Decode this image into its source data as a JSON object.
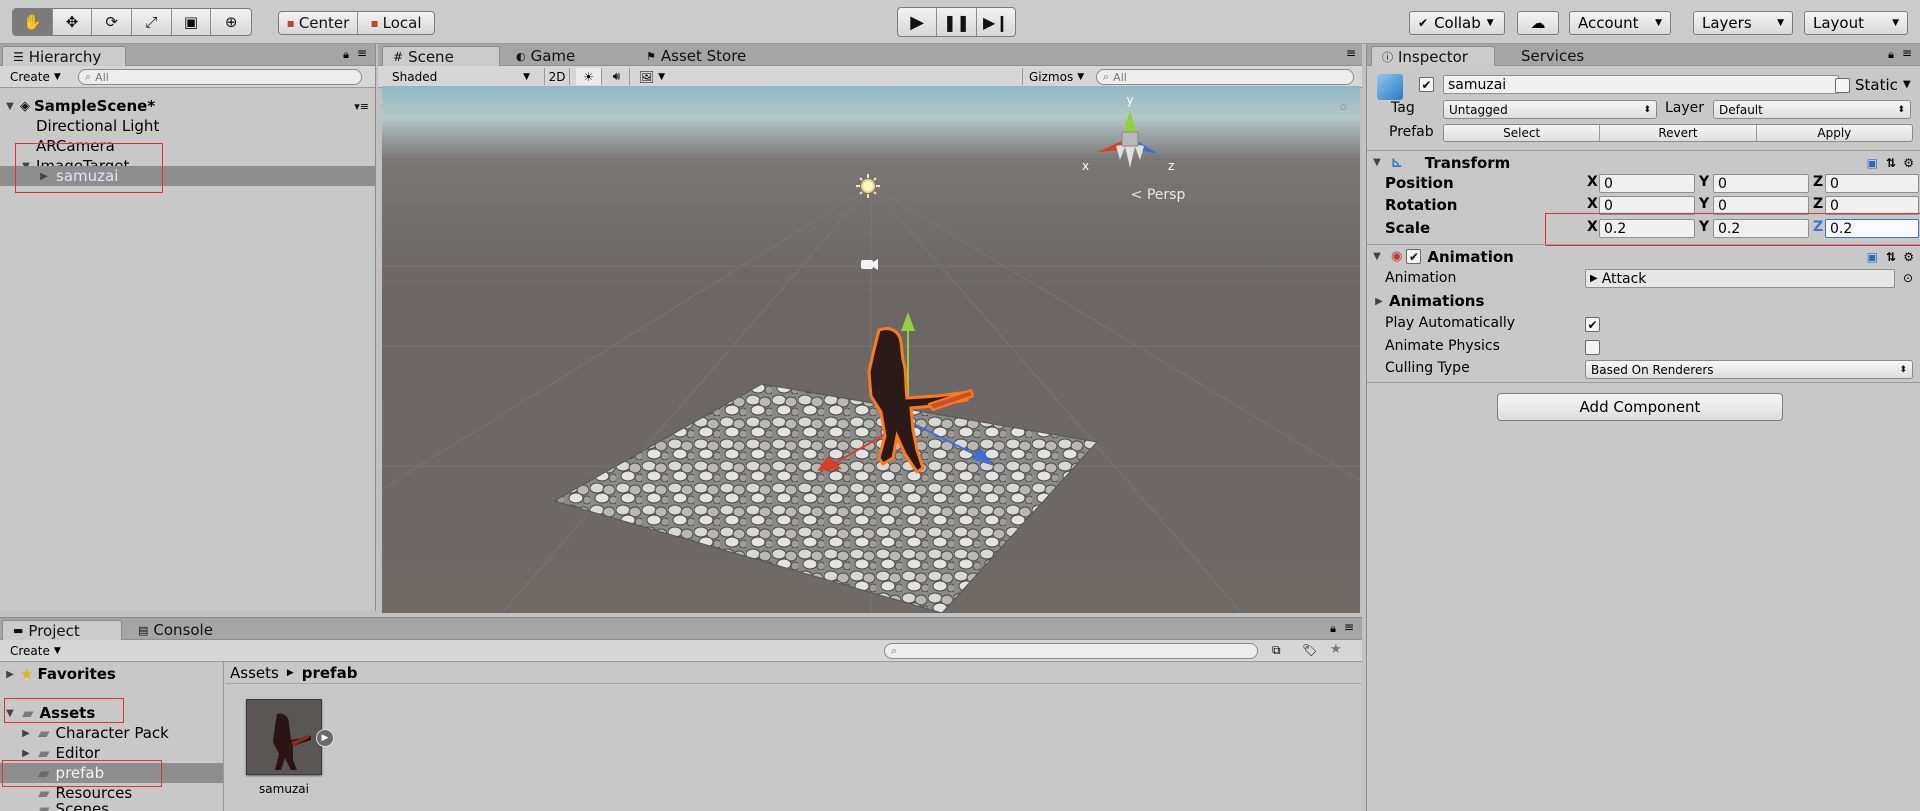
{
  "toolbar": {
    "tools": [
      "hand-tool-icon",
      "move-tool-icon",
      "rotate-tool-icon",
      "scale-tool-icon",
      "rect-tool-icon",
      "transform-tool-icon"
    ],
    "pivot": "Center",
    "space": "Local",
    "collab": "Collab",
    "account": "Account",
    "layers": "Layers",
    "layout": "Layout"
  },
  "hierarchy": {
    "tab": "Hierarchy",
    "create": "Create",
    "search_placeholder": "All",
    "scene": "SampleScene*",
    "items": [
      "Directional Light",
      "ARCamera",
      "ImageTarget",
      "samuzai"
    ]
  },
  "scene": {
    "tabs": [
      "Scene",
      "Game",
      "Asset Store"
    ],
    "shading": "Shaded",
    "mode2d": "2D",
    "gizmos": "Gizmos",
    "search_placeholder": "All",
    "persp": "Persp",
    "axes": {
      "x": "x",
      "y": "y",
      "z": "z"
    }
  },
  "inspector": {
    "tabs": [
      "Inspector",
      "Services"
    ],
    "object_name": "samuzai",
    "static_label": "Static",
    "tag_label": "Tag",
    "tag_value": "Untagged",
    "layer_label": "Layer",
    "layer_value": "Default",
    "prefab_label": "Prefab",
    "prefab_buttons": [
      "Select",
      "Revert",
      "Apply"
    ],
    "transform": {
      "title": "Transform",
      "position_label": "Position",
      "rotation_label": "Rotation",
      "scale_label": "Scale",
      "axis_x": "X",
      "axis_y": "Y",
      "axis_z": "Z",
      "position": [
        "0",
        "0",
        "0"
      ],
      "rotation": [
        "0",
        "0",
        "0"
      ],
      "scale": [
        "0.2",
        "0.2",
        "0.2"
      ]
    },
    "animation": {
      "title": "Animation",
      "animation_label": "Animation",
      "animation_value": "Attack",
      "animations_label": "Animations",
      "play_auto_label": "Play Automatically",
      "play_auto": true,
      "physics_label": "Animate Physics",
      "physics": false,
      "culling_label": "Culling Type",
      "culling_value": "Based On Renderers"
    },
    "add_component": "Add Component"
  },
  "project": {
    "tabs": [
      "Project",
      "Console"
    ],
    "create": "Create",
    "favorites": "Favorites",
    "assets": "Assets",
    "folders": [
      "Character Pack",
      "Editor",
      "prefab",
      "Resources",
      "Scenes"
    ],
    "breadcrumb": [
      "Assets",
      "prefab"
    ],
    "asset_name": "samuzai"
  },
  "colors": {
    "selection_blue": "#3a72d6",
    "highlight_red": "#e53030",
    "toolbar_bg": "#cbcbcb",
    "panel_bg": "#c8c8c8"
  }
}
